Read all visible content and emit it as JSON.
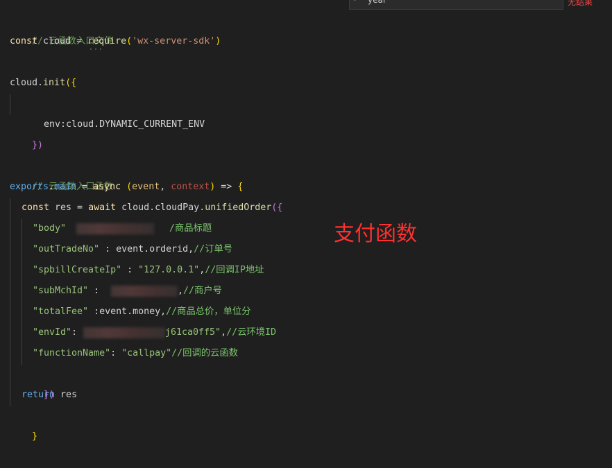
{
  "find_widget": {
    "query": "year",
    "result": "无结果"
  },
  "overlay_annotation": "支付函数",
  "code": {
    "l1": "// 云函数入口文件",
    "l2_kw": "const",
    "l2_var": " cloud = ",
    "l2_fn": "require",
    "l2_po": "(",
    "l2_str": "'wx-server-sdk'",
    "l2_pc": ")",
    "l2_dots": "···",
    "l3_obj": "cloud.",
    "l3_fn": "init",
    "l3_open": "({",
    "l4": "env:cloud.DYNAMIC_CURRENT_ENV",
    "l5": "})",
    "l6": "// 云函数入口函数",
    "l7_exp": "exports",
    "l7_dot": ".",
    "l7_main": "main",
    "l7_eq": " = ",
    "l7_async": "async",
    "l7_po": " (",
    "l7_event": "event",
    "l7_comma": ", ",
    "l7_ctx": "context",
    "l7_pc": ")",
    "l7_arrow": " => ",
    "l7_brace": "{",
    "l8_const": "const",
    "l8_res": " res = ",
    "l8_await": "await",
    "l8_cloud": " cloud.cloudPay.",
    "l8_fn": "unifiedOrder",
    "l8_open": "({",
    "l9_key": "\"body\"",
    "l9_cmt": "/商品标题",
    "l10_key": "\"outTradeNo\"",
    "l10_val": " : event.orderid,",
    "l10_cmt": "//订单号",
    "l11_key": "\"spbillCreateIp\"",
    "l11_sep": " : ",
    "l11_val": "\"127.0.0.1\"",
    "l11_comma": ",",
    "l11_cmt": "//回调IP地址",
    "l12_key": "\"subMchId\"",
    "l12_sep": " :",
    "l12_comma": ",",
    "l12_cmt": "//商户号",
    "l13_key": "\"totalFee\"",
    "l13_val": " :event.money,",
    "l13_cmt": "//商品总价，单位分",
    "l14_key": "\"envId\"",
    "l14_sep": ":",
    "l14_val": "j61ca0ff5\"",
    "l14_comma": ",",
    "l14_cmt": "//云环境ID",
    "l15_key": "\"functionName\"",
    "l15_sep": ": ",
    "l15_val": "\"callpay\"",
    "l15_cmt": "//回调的云函数",
    "l16": "})",
    "l17_kw": "return",
    "l17_var": " res",
    "l18": "}"
  }
}
